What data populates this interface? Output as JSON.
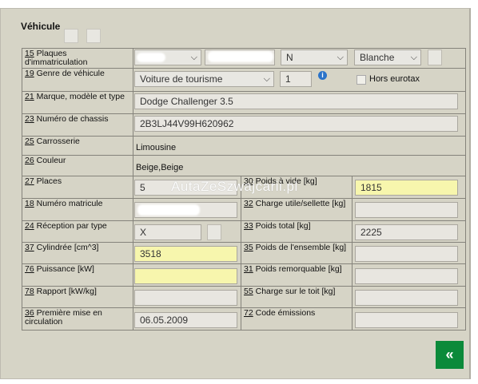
{
  "section_title": "Véhicule",
  "rows": {
    "plates": {
      "num": "15",
      "label": "Plaques d'immatriculation",
      "country_select": "N",
      "color_select": "Blanche"
    },
    "genre": {
      "num": "19",
      "label": "Genre de véhicule",
      "select": "Voiture de tourisme",
      "qty": "1",
      "hors_label": "Hors eurotax"
    },
    "marque": {
      "num": "21",
      "label": "Marque, modèle et type",
      "value": "Dodge Challenger 3.5"
    },
    "chassis": {
      "num": "23",
      "label": "Numéro de chassis",
      "value": "2B3LJ44V99H620962"
    },
    "carrosserie": {
      "num": "25",
      "label": "Carrosserie",
      "value": "Limousine"
    },
    "couleur": {
      "num": "26",
      "label": "Couleur",
      "value": "Beige,Beige"
    },
    "places": {
      "num": "27",
      "label": "Places",
      "value": "5"
    },
    "poids_vide": {
      "num": "30",
      "label": "Poids à vide [kg]",
      "value": "1815"
    },
    "matricule": {
      "num": "18",
      "label": "Numéro matricule",
      "value": ""
    },
    "charge_utile": {
      "num": "32",
      "label": "Charge utile/sellette [kg]",
      "value": ""
    },
    "reception": {
      "num": "24",
      "label": "Réception par type",
      "value": "X"
    },
    "poids_total": {
      "num": "33",
      "label": "Poids total [kg]",
      "value": "2225"
    },
    "cylindree": {
      "num": "37",
      "label": "Cylindrée [cm^3]",
      "value": "3518"
    },
    "poids_ensemble": {
      "num": "35",
      "label": "Poids de l'ensemble [kg]",
      "value": ""
    },
    "puissance": {
      "num": "76",
      "label": "Puissance [kW]",
      "value": ""
    },
    "poids_remorquable": {
      "num": "31",
      "label": "Poids remorquable [kg]",
      "value": ""
    },
    "rapport": {
      "num": "78",
      "label": "Rapport [kW/kg]",
      "value": ""
    },
    "charge_toit": {
      "num": "55",
      "label": "Charge sur le toit [kg]",
      "value": ""
    },
    "premiere": {
      "num": "36",
      "label": "Première mise en circulation",
      "value": "06.05.2009"
    },
    "code_emissions": {
      "num": "72",
      "label": "Code émissions",
      "value": ""
    }
  },
  "watermark": "AutaZeSzwajcarii.pl",
  "back_button": "«",
  "colors": {
    "panel": "#d6d4c6",
    "yellow_field": "#f7f6ad",
    "back_button": "#0b8a3a"
  }
}
